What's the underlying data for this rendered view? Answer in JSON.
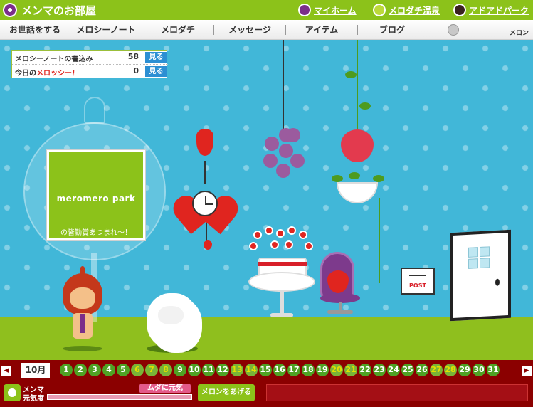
{
  "header": {
    "title": "メンマのお部屋",
    "links": [
      "マイホーム",
      "メロダチ温泉",
      "アドアドパーク"
    ]
  },
  "nav": {
    "items": [
      "お世話をする",
      "メロシーノート",
      "メロダチ",
      "メッセージ",
      "アイテム",
      "ブログ"
    ],
    "melon_label": "メロン"
  },
  "info": {
    "rows": [
      {
        "label": "メロシーノートの書込み",
        "count": "58",
        "button": "見る"
      },
      {
        "label_prefix": "今日の",
        "label_word": "メロッシー！",
        "count": "0",
        "button": "見る"
      }
    ]
  },
  "room": {
    "board_title": "meromero park",
    "board_message": "の皆勤賞あつまれ～！",
    "post_label": "POST"
  },
  "calendar": {
    "month": "10月",
    "days": [
      "1",
      "2",
      "3",
      "4",
      "5",
      "6",
      "7",
      "8",
      "9",
      "10",
      "11",
      "12",
      "13",
      "14",
      "15",
      "16",
      "17",
      "18",
      "19",
      "20",
      "21",
      "22",
      "23",
      "24",
      "25",
      "26",
      "27",
      "28",
      "29",
      "30",
      "31"
    ],
    "dim_days": [
      "6",
      "7",
      "8",
      "13",
      "14",
      "20",
      "21",
      "27",
      "28"
    ]
  },
  "status": {
    "name": "メンマ",
    "genki_label": "元気度",
    "badge": "ムダに元気",
    "feed_button": "メロンをあげる"
  },
  "colors": {
    "header_green": "#8cc21a",
    "room_blue": "#41b7d8",
    "floor_green": "#8fbf1e",
    "calendar_red": "#8b0000"
  }
}
